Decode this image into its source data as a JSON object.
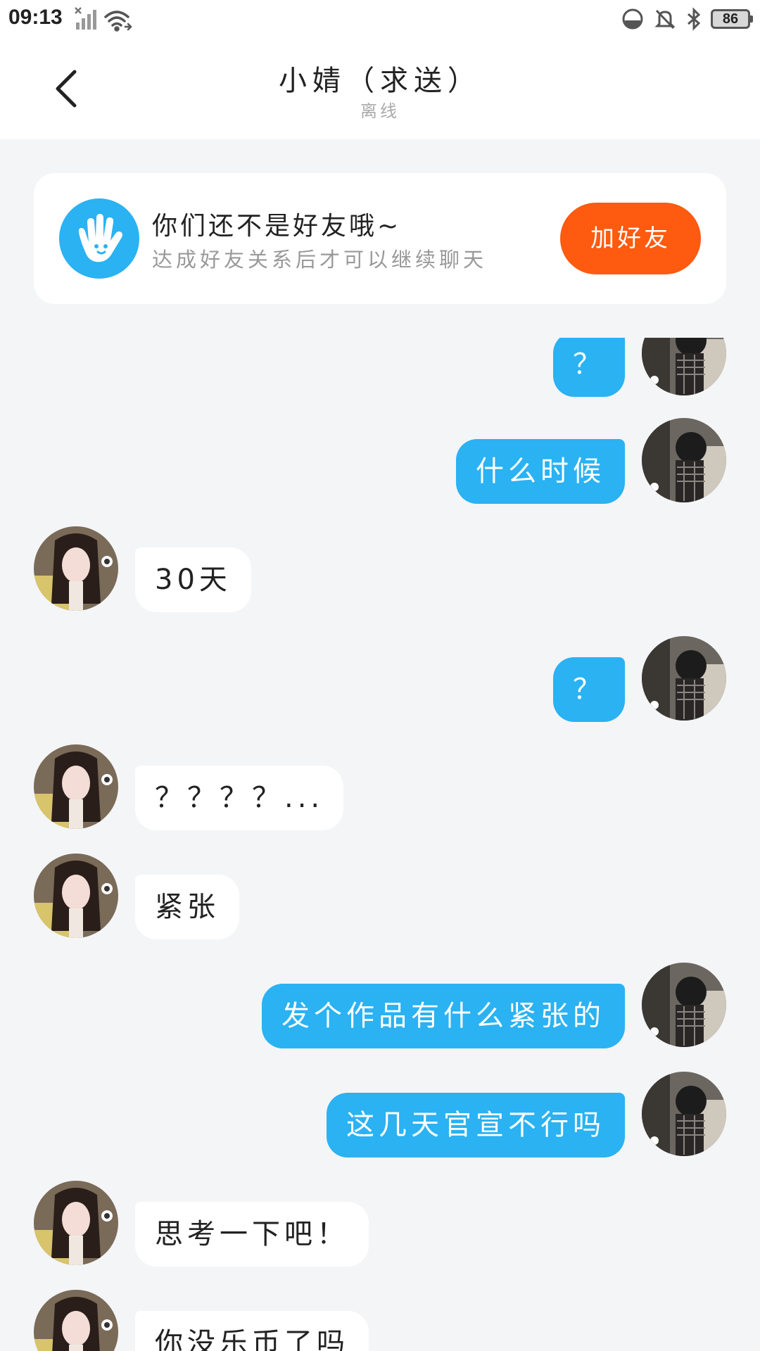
{
  "status_bar": {
    "time": "09:13",
    "battery": "86"
  },
  "header": {
    "title": "小婧（求送）",
    "subtitle": "离线",
    "back_icon": "chevron-left-icon"
  },
  "friend_prompt": {
    "title": "你们还不是好友哦~",
    "description": "达成好友关系后才可以继续聊天",
    "button_label": "加好友",
    "icon": "hand-wave-icon",
    "accent_color": "#2ab2f2",
    "button_color": "#fe5a10"
  },
  "messages": [
    {
      "side": "self",
      "text": "？"
    },
    {
      "side": "self",
      "text": "什么时候"
    },
    {
      "side": "other",
      "text": "30天"
    },
    {
      "side": "self",
      "text": "？"
    },
    {
      "side": "other",
      "text": "？？？？..."
    },
    {
      "side": "other",
      "text": "紧张"
    },
    {
      "side": "self",
      "text": "发个作品有什么紧张的"
    },
    {
      "side": "self",
      "text": "这几天官宣不行吗"
    },
    {
      "side": "other",
      "text": "思考一下吧！"
    },
    {
      "side": "other",
      "text": "你没乐币了吗"
    }
  ],
  "colors": {
    "self_bubble": "#2ab2f2",
    "other_bubble": "#ffffff",
    "background": "#f4f5f7"
  }
}
